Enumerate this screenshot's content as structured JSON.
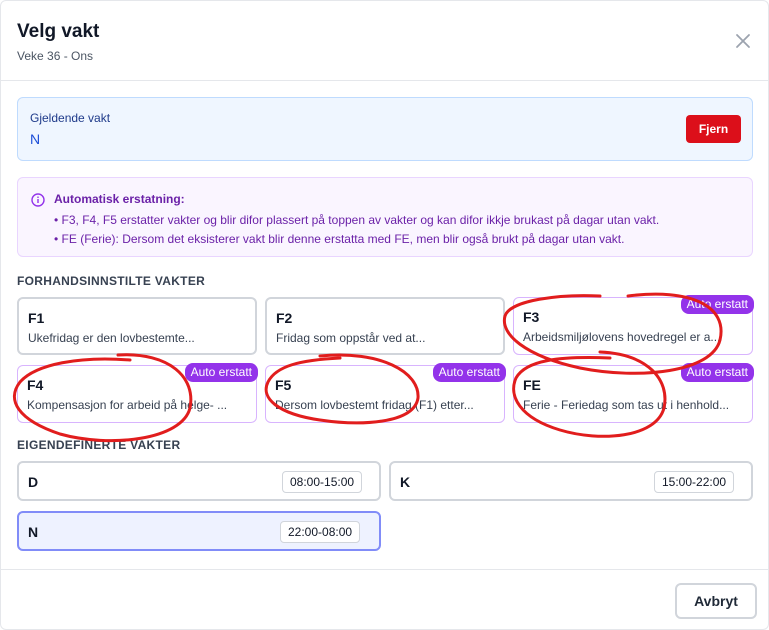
{
  "header": {
    "title": "Velg vakt",
    "subtitle": "Veke 36 - Ons",
    "close_icon": "close-icon"
  },
  "current_shift": {
    "label": "Gjeldende vakt",
    "value": "N",
    "remove_label": "Fjern"
  },
  "info": {
    "icon": "info-icon",
    "heading": "Automatisk erstatning:",
    "items": [
      "• F3, F4, F5 erstatter vakter og blir difor plassert på toppen av vakter og kan difor ikkje brukast på dagar utan vakt.",
      "• FE (Ferie): Dersom det eksisterer vakt blir denne erstatta med FE, men blir også brukt på dagar utan vakt."
    ]
  },
  "preset": {
    "heading": "FORHANDSINNSTILTE VAKTER",
    "cards": [
      {
        "code": "F1",
        "desc": "Ukefridag er den lovbestemte...",
        "badge": ""
      },
      {
        "code": "F2",
        "desc": "Fridag som oppstår ved at...",
        "badge": ""
      },
      {
        "code": "F3",
        "desc": "Arbeidsmiljølovens hovedregel er a...",
        "badge": "Auto erstatt"
      },
      {
        "code": "F4",
        "desc": "Kompensasjon for arbeid på helge- ...",
        "badge": "Auto erstatt"
      },
      {
        "code": "F5",
        "desc": "Dersom lovbestemt fridag (F1) etter...",
        "badge": "Auto erstatt"
      },
      {
        "code": "FE",
        "desc": "Ferie - Feriedag som tas ut i henhold...",
        "badge": "Auto erstatt"
      }
    ]
  },
  "custom": {
    "heading": "EIGENDEFINERTE VAKTER",
    "items": [
      {
        "code": "D",
        "time": "08:00-15:00"
      },
      {
        "code": "K",
        "time": "15:00-22:00"
      },
      {
        "code": "N",
        "time": "22:00-08:00"
      }
    ]
  },
  "footer": {
    "cancel_label": "Avbryt"
  },
  "colors": {
    "accent": "#9333ea",
    "danger": "#dc0f1a",
    "selected": "#818cf8",
    "annotation": "#e11d1d"
  }
}
